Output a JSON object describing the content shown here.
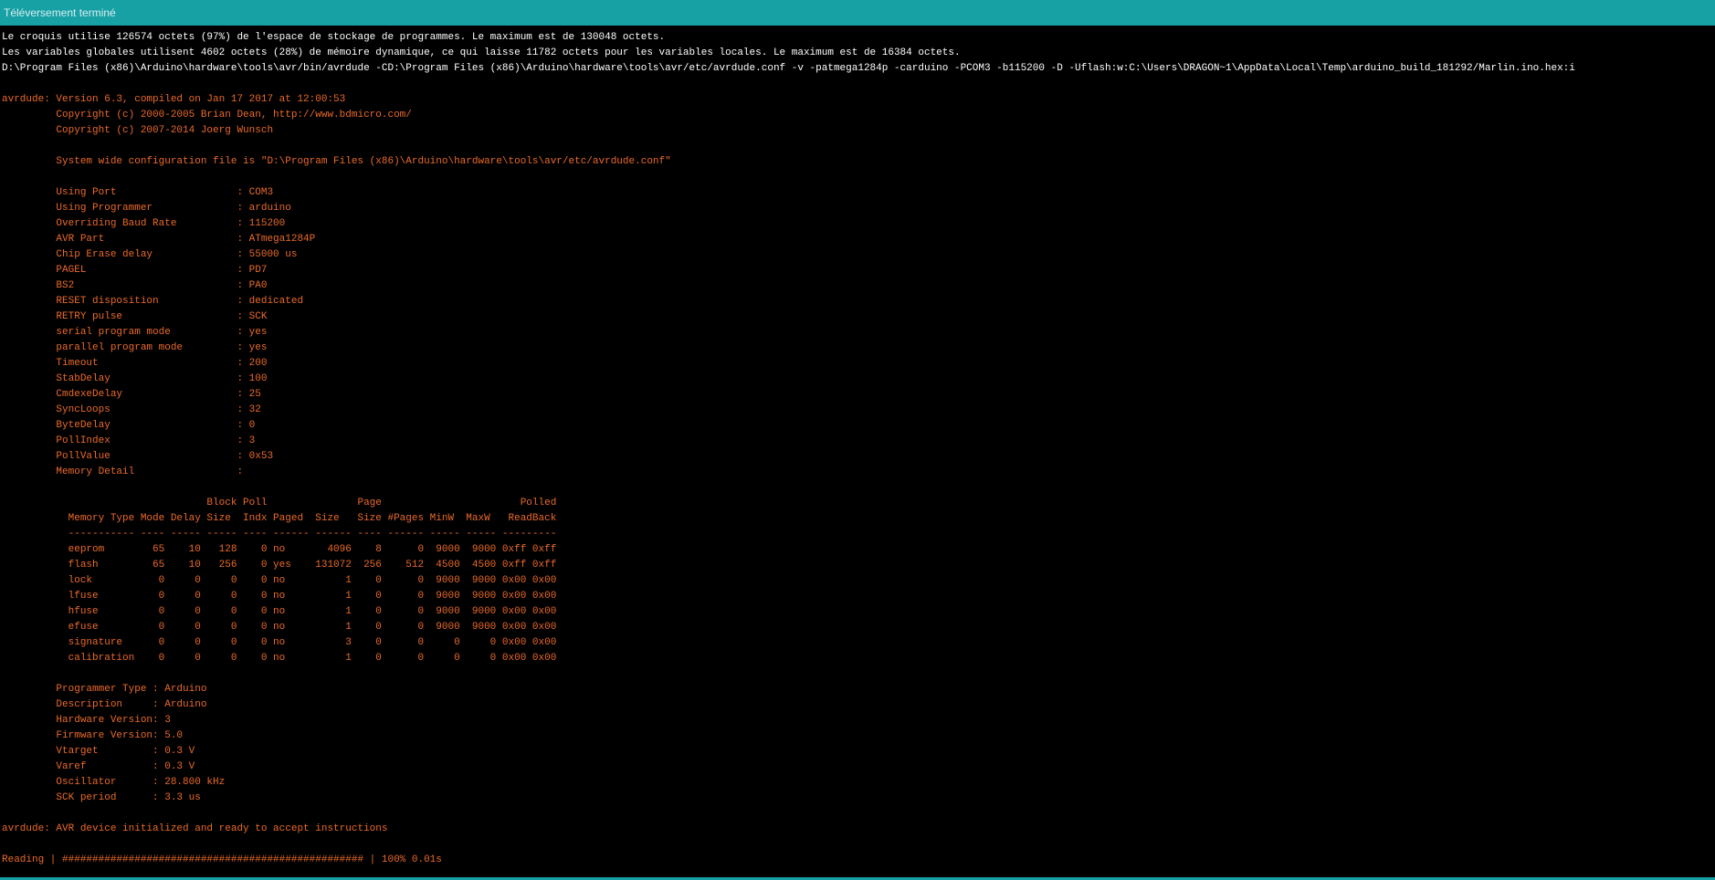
{
  "status": {
    "text": "Téléversement terminé"
  },
  "console": {
    "lines": [
      {
        "text": "Le croquis utilise 126574 octets (97%) de l'espace de stockage de programmes. Le maximum est de 130048 octets.",
        "kind": "info"
      },
      {
        "text": "Les variables globales utilisent 4602 octets (28%) de mémoire dynamique, ce qui laisse 11782 octets pour les variables locales. Le maximum est de 16384 octets.",
        "kind": "info"
      },
      {
        "text": "D:\\Program Files (x86)\\Arduino\\hardware\\tools\\avr/bin/avrdude -CD:\\Program Files (x86)\\Arduino\\hardware\\tools\\avr/etc/avrdude.conf -v -patmega1284p -carduino -PCOM3 -b115200 -D -Uflash:w:C:\\Users\\DRAGON~1\\AppData\\Local\\Temp\\arduino_build_181292/Marlin.ino.hex:i",
        "kind": "info"
      },
      {
        "text": "",
        "kind": "log"
      },
      {
        "text": "avrdude: Version 6.3, compiled on Jan 17 2017 at 12:00:53",
        "kind": "log"
      },
      {
        "text": "         Copyright (c) 2000-2005 Brian Dean, http://www.bdmicro.com/",
        "kind": "log"
      },
      {
        "text": "         Copyright (c) 2007-2014 Joerg Wunsch",
        "kind": "log"
      },
      {
        "text": "",
        "kind": "log"
      },
      {
        "text": "         System wide configuration file is \"D:\\Program Files (x86)\\Arduino\\hardware\\tools\\avr/etc/avrdude.conf\"",
        "kind": "log"
      },
      {
        "text": "",
        "kind": "log"
      },
      {
        "text": "         Using Port                    : COM3",
        "kind": "log"
      },
      {
        "text": "         Using Programmer              : arduino",
        "kind": "log"
      },
      {
        "text": "         Overriding Baud Rate          : 115200",
        "kind": "log"
      },
      {
        "text": "         AVR Part                      : ATmega1284P",
        "kind": "log"
      },
      {
        "text": "         Chip Erase delay              : 55000 us",
        "kind": "log"
      },
      {
        "text": "         PAGEL                         : PD7",
        "kind": "log"
      },
      {
        "text": "         BS2                           : PA0",
        "kind": "log"
      },
      {
        "text": "         RESET disposition             : dedicated",
        "kind": "log"
      },
      {
        "text": "         RETRY pulse                   : SCK",
        "kind": "log"
      },
      {
        "text": "         serial program mode           : yes",
        "kind": "log"
      },
      {
        "text": "         parallel program mode         : yes",
        "kind": "log"
      },
      {
        "text": "         Timeout                       : 200",
        "kind": "log"
      },
      {
        "text": "         StabDelay                     : 100",
        "kind": "log"
      },
      {
        "text": "         CmdexeDelay                   : 25",
        "kind": "log"
      },
      {
        "text": "         SyncLoops                     : 32",
        "kind": "log"
      },
      {
        "text": "         ByteDelay                     : 0",
        "kind": "log"
      },
      {
        "text": "         PollIndex                     : 3",
        "kind": "log"
      },
      {
        "text": "         PollValue                     : 0x53",
        "kind": "log"
      },
      {
        "text": "         Memory Detail                 :",
        "kind": "log"
      },
      {
        "text": "",
        "kind": "log"
      },
      {
        "text": "                                  Block Poll               Page                       Polled",
        "kind": "log"
      },
      {
        "text": "           Memory Type Mode Delay Size  Indx Paged  Size   Size #Pages MinW  MaxW   ReadBack",
        "kind": "log"
      },
      {
        "text": "           ----------- ---- ----- ----- ---- ------ ------ ---- ------ ----- ----- ---------",
        "kind": "log"
      },
      {
        "text": "           eeprom        65    10   128    0 no       4096    8      0  9000  9000 0xff 0xff",
        "kind": "log"
      },
      {
        "text": "           flash         65    10   256    0 yes    131072  256    512  4500  4500 0xff 0xff",
        "kind": "log"
      },
      {
        "text": "           lock           0     0     0    0 no          1    0      0  9000  9000 0x00 0x00",
        "kind": "log"
      },
      {
        "text": "           lfuse          0     0     0    0 no          1    0      0  9000  9000 0x00 0x00",
        "kind": "log"
      },
      {
        "text": "           hfuse          0     0     0    0 no          1    0      0  9000  9000 0x00 0x00",
        "kind": "log"
      },
      {
        "text": "           efuse          0     0     0    0 no          1    0      0  9000  9000 0x00 0x00",
        "kind": "log"
      },
      {
        "text": "           signature      0     0     0    0 no          3    0      0     0     0 0x00 0x00",
        "kind": "log"
      },
      {
        "text": "           calibration    0     0     0    0 no          1    0      0     0     0 0x00 0x00",
        "kind": "log"
      },
      {
        "text": "",
        "kind": "log"
      },
      {
        "text": "         Programmer Type : Arduino",
        "kind": "log"
      },
      {
        "text": "         Description     : Arduino",
        "kind": "log"
      },
      {
        "text": "         Hardware Version: 3",
        "kind": "log"
      },
      {
        "text": "         Firmware Version: 5.0",
        "kind": "log"
      },
      {
        "text": "         Vtarget         : 0.3 V",
        "kind": "log"
      },
      {
        "text": "         Varef           : 0.3 V",
        "kind": "log"
      },
      {
        "text": "         Oscillator      : 28.800 kHz",
        "kind": "log"
      },
      {
        "text": "         SCK period      : 3.3 us",
        "kind": "log"
      },
      {
        "text": "",
        "kind": "log"
      },
      {
        "text": "avrdude: AVR device initialized and ready to accept instructions",
        "kind": "log"
      },
      {
        "text": "",
        "kind": "log"
      },
      {
        "text": "Reading | ################################################## | 100% 0.01s",
        "kind": "log"
      }
    ]
  },
  "colors": {
    "status_bar": "#17a1a5",
    "console_background": "#000000",
    "info_text": "#ffffff",
    "log_text": "#ea6a2a"
  }
}
